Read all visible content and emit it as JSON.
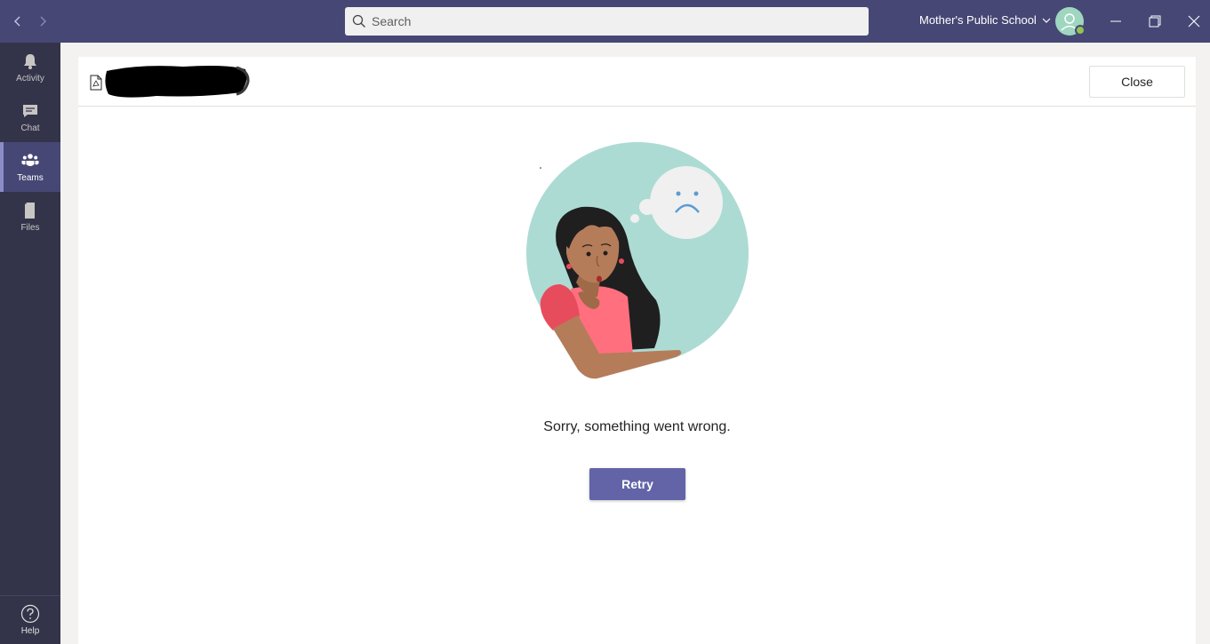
{
  "titlebar": {
    "back_icon": "chevron-left-icon",
    "forward_icon": "chevron-right-icon",
    "search": {
      "placeholder": "Search",
      "value": ""
    },
    "org_name": "Mother's Public School",
    "window_controls": [
      "minimize-icon",
      "restore-icon",
      "close-icon"
    ]
  },
  "appbar": {
    "items": [
      {
        "label": "Activity",
        "icon": "bell-icon",
        "active": false
      },
      {
        "label": "Chat",
        "icon": "chat-icon",
        "active": false
      },
      {
        "label": "Teams",
        "icon": "teams-icon",
        "active": true
      },
      {
        "label": "Files",
        "icon": "file-icon",
        "active": false
      }
    ],
    "help_label": "Help"
  },
  "viewer": {
    "file_icon": "pdf-file-icon",
    "file_name_redacted": true,
    "close_label": "Close",
    "error_message": "Sorry, something went wrong.",
    "retry_label": "Retry"
  },
  "colors": {
    "titlebar": "#464775",
    "appbar": "#33344a",
    "accent": "#6264a7",
    "illustration_circle": "#acdbd3"
  }
}
